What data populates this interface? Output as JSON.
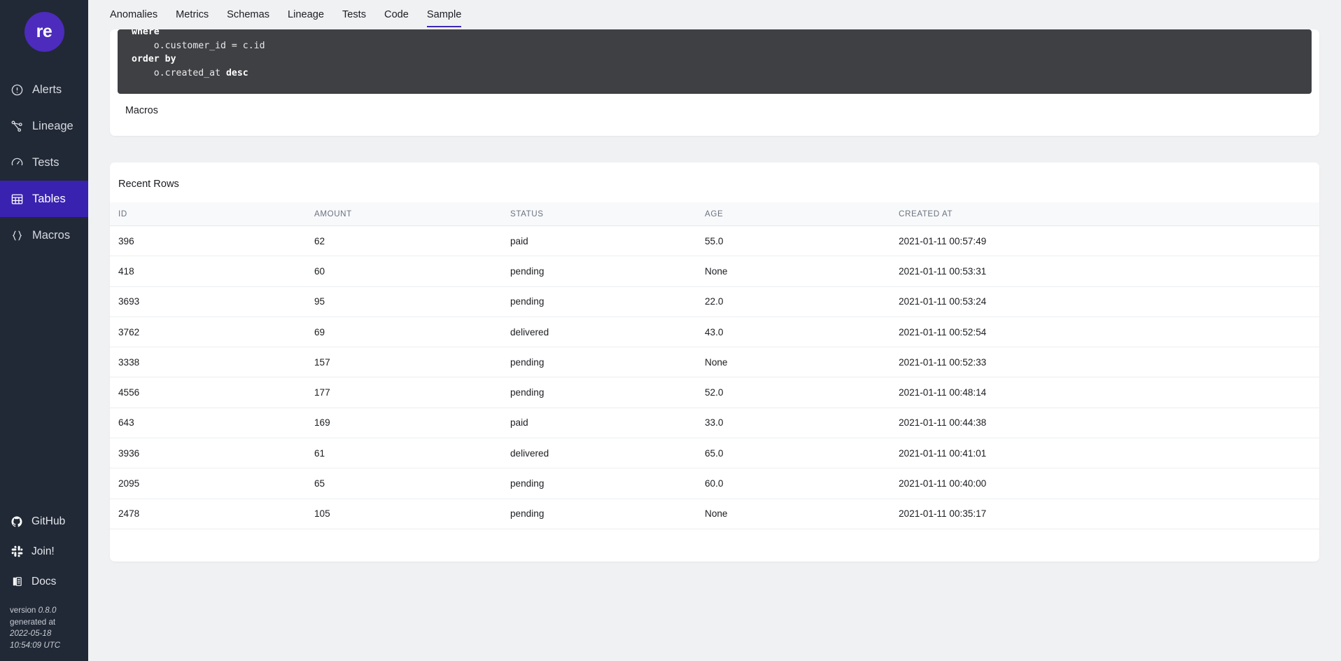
{
  "sidebar": {
    "logo_text": "re",
    "nav": [
      {
        "label": "Alerts",
        "icon": "alert-circle-icon",
        "active": false
      },
      {
        "label": "Lineage",
        "icon": "lineage-icon",
        "active": false
      },
      {
        "label": "Tests",
        "icon": "gauge-icon",
        "active": false
      },
      {
        "label": "Tables",
        "icon": "table-grid-icon",
        "active": true
      },
      {
        "label": "Macros",
        "icon": "curly-braces-icon",
        "active": false
      }
    ],
    "links": [
      {
        "label": "GitHub",
        "icon": "github-icon"
      },
      {
        "label": "Join!",
        "icon": "slack-icon"
      },
      {
        "label": "Docs",
        "icon": "docs-icon"
      }
    ],
    "version_label": "version",
    "version_value": "0.8.0",
    "generated_label": "generated at",
    "generated_value_line1": "2022-05-18",
    "generated_value_line2": "10:54:09 UTC",
    "active_bg": "#3a22b0",
    "bg": "#212936"
  },
  "tabs": [
    {
      "label": "Anomalies",
      "active": false
    },
    {
      "label": "Metrics",
      "active": false
    },
    {
      "label": "Schemas",
      "active": false
    },
    {
      "label": "Lineage",
      "active": false
    },
    {
      "label": "Tests",
      "active": false
    },
    {
      "label": "Code",
      "active": false
    },
    {
      "label": "Sample",
      "active": true
    }
  ],
  "code_card": {
    "lines": [
      {
        "parts": [
          {
            "t": "where",
            "kw": true
          }
        ]
      },
      {
        "parts": [
          {
            "t": "    o.customer_id = c.id",
            "kw": false
          }
        ]
      },
      {
        "parts": [
          {
            "t": "order by",
            "kw": true
          }
        ]
      },
      {
        "parts": [
          {
            "t": "    o.created_at ",
            "kw": false
          },
          {
            "t": "desc",
            "kw": true
          }
        ]
      }
    ],
    "macros_label": "Macros"
  },
  "rows_card": {
    "title": "Recent Rows",
    "columns": [
      "ID",
      "AMOUNT",
      "STATUS",
      "AGE",
      "CREATED AT"
    ],
    "rows": [
      [
        "396",
        "62",
        "paid",
        "55.0",
        "2021-01-11 00:57:49"
      ],
      [
        "418",
        "60",
        "pending",
        "None",
        "2021-01-11 00:53:31"
      ],
      [
        "3693",
        "95",
        "pending",
        "22.0",
        "2021-01-11 00:53:24"
      ],
      [
        "3762",
        "69",
        "delivered",
        "43.0",
        "2021-01-11 00:52:54"
      ],
      [
        "3338",
        "157",
        "pending",
        "None",
        "2021-01-11 00:52:33"
      ],
      [
        "4556",
        "177",
        "pending",
        "52.0",
        "2021-01-11 00:48:14"
      ],
      [
        "643",
        "169",
        "paid",
        "33.0",
        "2021-01-11 00:44:38"
      ],
      [
        "3936",
        "61",
        "delivered",
        "65.0",
        "2021-01-11 00:41:01"
      ],
      [
        "2095",
        "65",
        "pending",
        "60.0",
        "2021-01-11 00:40:00"
      ],
      [
        "2478",
        "105",
        "pending",
        "None",
        "2021-01-11 00:35:17"
      ]
    ]
  },
  "colors": {
    "accent": "#3f28b8",
    "logo_bg": "#4c2bbd",
    "page_bg": "#f0f1f3",
    "code_bg": "#3f4044"
  }
}
